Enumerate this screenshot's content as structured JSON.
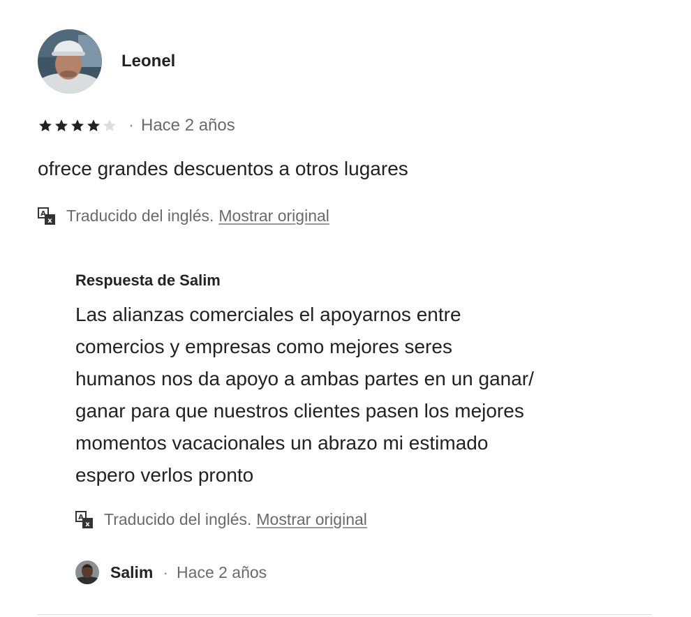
{
  "review": {
    "reviewer_name": "Leonel",
    "rating": 4,
    "rating_max": 5,
    "date_separator": "·",
    "date": "Hace 2 años",
    "text": "ofrece grandes descuentos a otros lugares",
    "translation_note": "Traducido del inglés.",
    "show_original_label": "Mostrar original"
  },
  "response": {
    "title": "Respuesta de Salim",
    "lines": [
      "Las alianzas comerciales el apoyarnos entre",
      "comercios y empresas como mejores seres",
      "humanos nos da apoyo a ambas partes en un ganar/",
      "ganar para que nuestros clientes pasen los mejores",
      "momentos vacacionales un abrazo mi estimado",
      "espero verlos pronto"
    ],
    "translation_note": "Traducido del inglés.",
    "show_original_label": "Mostrar original",
    "host_name": "Salim",
    "date_separator": "·",
    "date": "Hace 2 años"
  },
  "icons": {
    "star": "star-icon",
    "translate": "translate-icon"
  },
  "colors": {
    "star_filled": "#222222",
    "star_empty": "#dddddd",
    "secondary_text": "#6a6a6a",
    "primary_text": "#222222"
  }
}
